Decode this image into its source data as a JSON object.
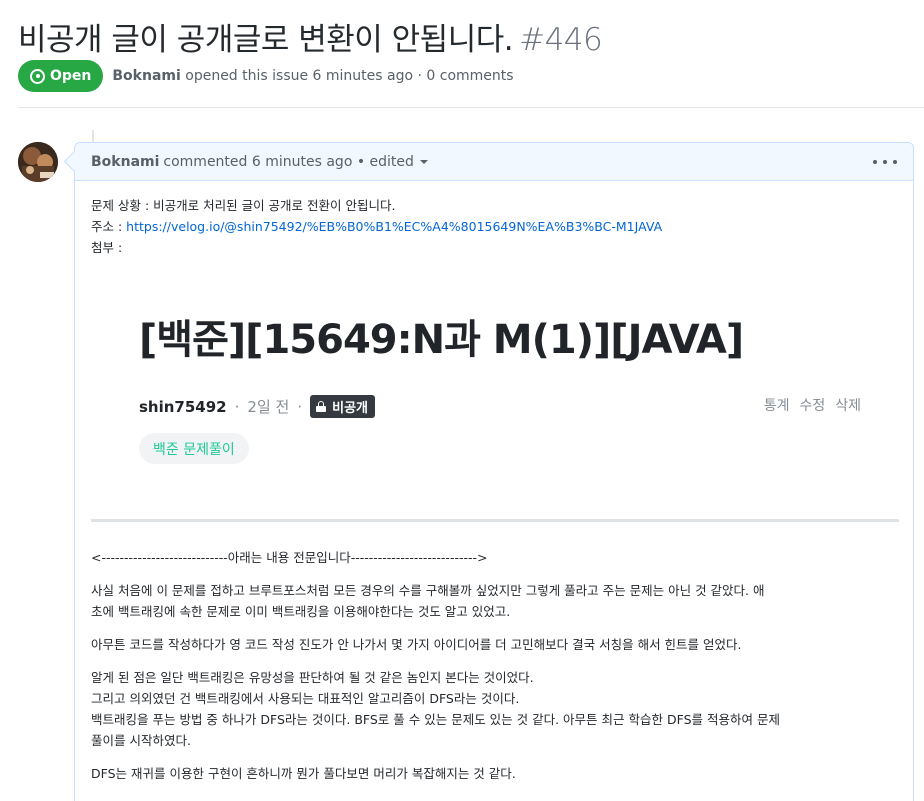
{
  "issue": {
    "title": "비공개 글이 공개글로 변환이 안됩니다.",
    "number": "#446",
    "state": "Open",
    "author": "Boknami",
    "meta": "opened this issue 6 minutes ago · 0 comments"
  },
  "comment": {
    "author": "Boknami",
    "meta": "commented 6 minutes ago • edited",
    "body": {
      "problem": "문제 상황 : 비공개로 처리된 글이 공개로 전환이 안됩니다.",
      "address_label": "주소 :",
      "address_url": "https://velog.io/@shin75492/%EB%B0%B1%EC%A4%8015649N%EA%B3%BC-M1JAVA",
      "attachment_label": "첨부 :"
    },
    "embed": {
      "title": "[백준][15649:N과 M(1)][JAVA]",
      "user": "shin75492",
      "separator": "·",
      "date": "2일 전",
      "private_label": "비공개",
      "actions": [
        "통계",
        "수정",
        "삭제"
      ],
      "tag": "백준 문제풀이"
    },
    "article": {
      "divider": "<----------------------------아래는 내용 전문입니다---------------------------->",
      "para1_line1": "사실 처음에 이 문제를 접하고 브루트포스처럼 모든 경우의 수를 구해볼까 싶었지만 그렇게 풀라고 주는 문제는 아닌 것 같았다. 애",
      "para1_line2": "초에 백트래킹에 속한 문제로 이미 백트래킹을 이용해야한다는 것도 알고 있었고.",
      "para2": "아무튼 코드를 작성하다가 영 코드 작성 진도가 안 나가서 몇 가지 아이디어를 더 고민해보다 결국 서칭을 해서 힌트를 얻었다.",
      "para3_line1": "알게 된 점은 일단 백트래킹은 유망성을 판단하여 될 것 같은 놈인지 본다는 것이었다.",
      "para3_line2": "그리고 의외였던 건 백트래킹에서 사용되는 대표적인 알고리즘이 DFS라는 것이다.",
      "para3_line3": "백트래킹을 푸는 방법 중 하나가 DFS라는 것이다. BFS로 풀 수 있는 문제도 있는 것 같다. 아무튼 최근 학습한 DFS를 적용하여 문제",
      "para3_line4": "풀이를 시작하였다.",
      "para4": "DFS는 재귀를 이용한 구현이 흔하니까 뭔가 풀다보면 머리가 복잡해지는 것 같다."
    }
  },
  "colors": {
    "open_green": "#28a745",
    "link_blue": "#0366d6",
    "header_bg": "#f1f8ff",
    "header_border": "#c8e1ff",
    "tag_green": "#20c997"
  }
}
